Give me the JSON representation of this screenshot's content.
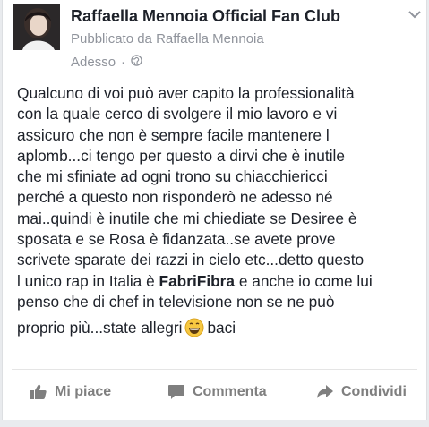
{
  "post": {
    "page_name": "Raffaella Mennoia Official Fan Club",
    "subtitle": "Pubblicato da Raffaella Mennoia",
    "time": "Adesso",
    "separator": "·",
    "icons": {
      "avatar": "profile-photo",
      "audience": "globe-icon",
      "menu": "chevron-down-icon",
      "emoji": "grinning-face-emoji"
    },
    "body": {
      "lines": [
        "Qualcuno di voi può aver capito la professionalità",
        "con la quale cerco di svolgere il mio lavoro e vi",
        "assicuro che non è sempre facile mantenere l",
        "aplomb...ci tengo per questo a dirvi che è inutile",
        "che mi sfiniate ad ogni trono su chiacchiericci",
        "perché a questo non risponderò ne adesso né",
        "mai..quindi è inutile che mi chiediate se Desiree è",
        "sposata e se Rosa è fidanzata..se avete prove",
        "scrivete sparate dei razzi in cielo etc...detto questo"
      ],
      "line10_before": "l unico rap in Italia è ",
      "line10_bold": "FabriFibra",
      "line10_after": " e anche io come lui",
      "line11": "penso che di chef in televisione non se ne può",
      "line12_before": "proprio più...state allegri",
      "line12_after": "baci"
    }
  },
  "actions": {
    "like_label": "Mi piace",
    "comment_label": "Commenta",
    "share_label": "Condividi"
  },
  "colors": {
    "text": "#1d2129",
    "secondary": "#90949c",
    "action": "#7f7f7f",
    "background": "#e9ebee"
  }
}
